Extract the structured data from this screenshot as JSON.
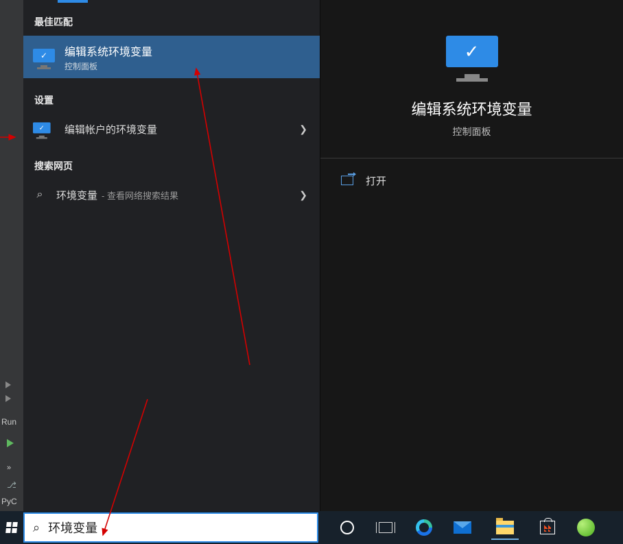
{
  "sections": {
    "best_match": "最佳匹配",
    "settings": "设置",
    "web": "搜索网页"
  },
  "best_match_item": {
    "title": "编辑系统环境变量",
    "sub": "控制面板"
  },
  "settings_item": {
    "title": "编辑帐户的环境变量"
  },
  "web_item": {
    "title": "环境变量",
    "hint": "- 查看网络搜索结果"
  },
  "detail": {
    "title": "编辑系统环境变量",
    "sub": "控制面板",
    "open": "打开"
  },
  "search": {
    "value": "环境变量"
  },
  "bg": {
    "run": "Run",
    "pyc": "PyC",
    "chevrons": "»"
  }
}
